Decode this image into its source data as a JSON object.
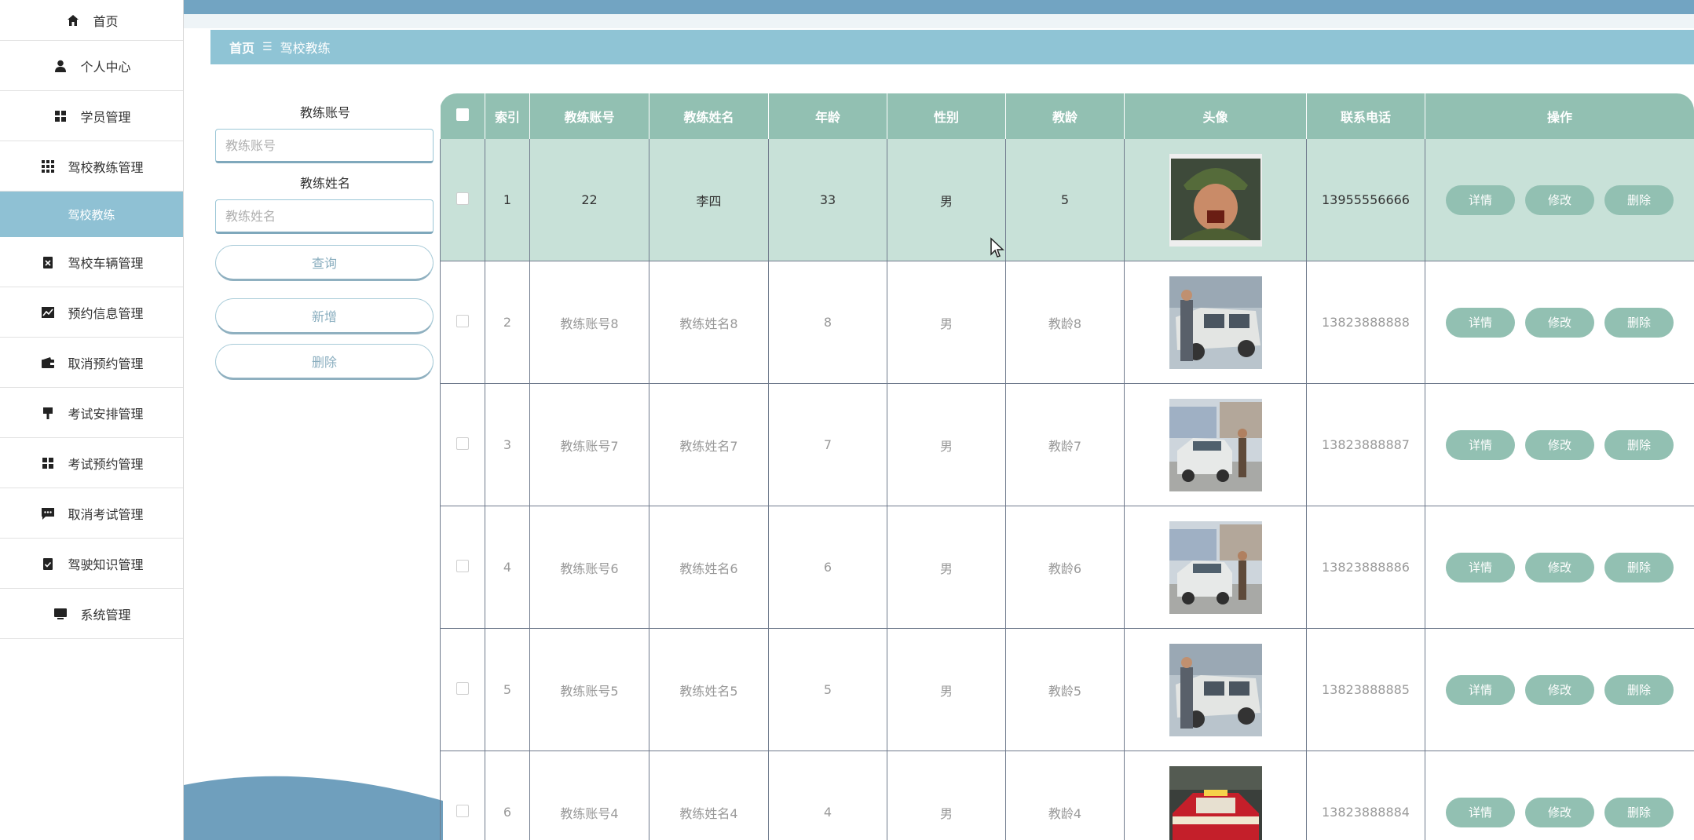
{
  "sidebar": {
    "items": [
      {
        "label": "首页",
        "icon": "home-icon"
      },
      {
        "label": "个人中心",
        "icon": "user-icon"
      },
      {
        "label": "学员管理",
        "icon": "grid-icon"
      },
      {
        "label": "驾校教练管理",
        "icon": "apps-icon"
      },
      {
        "label": "驾校教练",
        "icon": "",
        "sub": true
      },
      {
        "label": "驾校车辆管理",
        "icon": "clipboard-x-icon"
      },
      {
        "label": "预约信息管理",
        "icon": "chart-icon"
      },
      {
        "label": "取消预约管理",
        "icon": "wallet-icon"
      },
      {
        "label": "考试安排管理",
        "icon": "brush-icon"
      },
      {
        "label": "考试预约管理",
        "icon": "grid-icon"
      },
      {
        "label": "取消考试管理",
        "icon": "chat-icon"
      },
      {
        "label": "驾驶知识管理",
        "icon": "clipboard-check-icon"
      },
      {
        "label": "系统管理",
        "icon": "monitor-icon"
      }
    ]
  },
  "breadcrumb": {
    "home": "首页",
    "sep": "☰",
    "current": "驾校教练"
  },
  "search": {
    "account_label": "教练账号",
    "account_placeholder": "教练账号",
    "name_label": "教练姓名",
    "name_placeholder": "教练姓名",
    "query_button": "查询",
    "add_button": "新增",
    "delete_button": "删除"
  },
  "table": {
    "headers": [
      "索引",
      "教练账号",
      "教练姓名",
      "年龄",
      "性别",
      "教龄",
      "头像",
      "联系电话",
      "操作"
    ],
    "rows": [
      {
        "index": "1",
        "account": "22",
        "name": "李四",
        "age": "33",
        "gender": "男",
        "years": "5",
        "phone": "13955556666",
        "photo": "soldier"
      },
      {
        "index": "2",
        "account": "教练账号8",
        "name": "教练姓名8",
        "age": "8",
        "gender": "男",
        "years": "教龄8",
        "phone": "13823888888",
        "photo": "car-man"
      },
      {
        "index": "3",
        "account": "教练账号7",
        "name": "教练姓名7",
        "age": "7",
        "gender": "男",
        "years": "教龄7",
        "phone": "13823888887",
        "photo": "car-street"
      },
      {
        "index": "4",
        "account": "教练账号6",
        "name": "教练姓名6",
        "age": "6",
        "gender": "男",
        "years": "教龄6",
        "phone": "13823888886",
        "photo": "car-street"
      },
      {
        "index": "5",
        "account": "教练账号5",
        "name": "教练姓名5",
        "age": "5",
        "gender": "男",
        "years": "教龄5",
        "phone": "13823888885",
        "photo": "car-man"
      },
      {
        "index": "6",
        "account": "教练账号4",
        "name": "教练姓名4",
        "age": "4",
        "gender": "男",
        "years": "教龄4",
        "phone": "13823888884",
        "photo": "taxi"
      }
    ],
    "actions": {
      "detail": "详情",
      "edit": "修改",
      "delete": "删除"
    }
  },
  "colors": {
    "accent": "#92c0b2",
    "header_blue": "#72a4c2",
    "breadcrumb": "#8fc4d5",
    "highlight_row": "#c8e1d8"
  }
}
